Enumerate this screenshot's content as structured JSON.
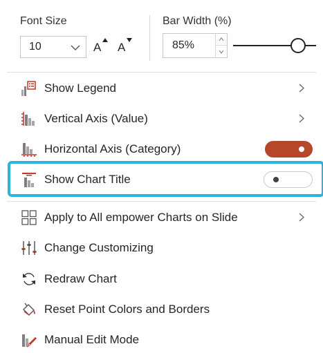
{
  "toolbar": {
    "font_size_label": "Font Size",
    "font_size_value": "10",
    "increase_font_label": "A",
    "decrease_font_label": "A",
    "bar_width_label": "Bar Width (%)",
    "bar_width_value": "85%",
    "bar_width_slider_level": 0.85
  },
  "menu": {
    "show_legend": "Show Legend",
    "vertical_axis": "Vertical Axis (Value)",
    "horizontal_axis": "Horizontal Axis (Category)",
    "horizontal_axis_toggle": "on",
    "show_chart_title": "Show Chart Title",
    "show_chart_title_toggle": "off",
    "apply_all": "Apply to All empower Charts on Slide",
    "change_customizing": "Change Customizing",
    "redraw_chart": "Redraw Chart",
    "reset_point_colors": "Reset Point Colors and Borders",
    "manual_edit_mode": "Manual Edit Mode"
  },
  "colors": {
    "accent_toggle": "#b7472a",
    "highlight": "#2eb3d8",
    "icon_red": "#c0392b",
    "icon_gray": "#7f7f7f"
  },
  "icons": {
    "legend": "legend-icon",
    "vertical_axis": "vertical-axis-icon",
    "horizontal_axis": "horizontal-axis-icon",
    "chart_title": "chart-title-icon",
    "apply_all": "grid-icon",
    "customizing": "sliders-icon",
    "redraw": "refresh-icon",
    "reset": "paint-bucket-icon",
    "manual_edit": "pencil-chart-icon"
  }
}
